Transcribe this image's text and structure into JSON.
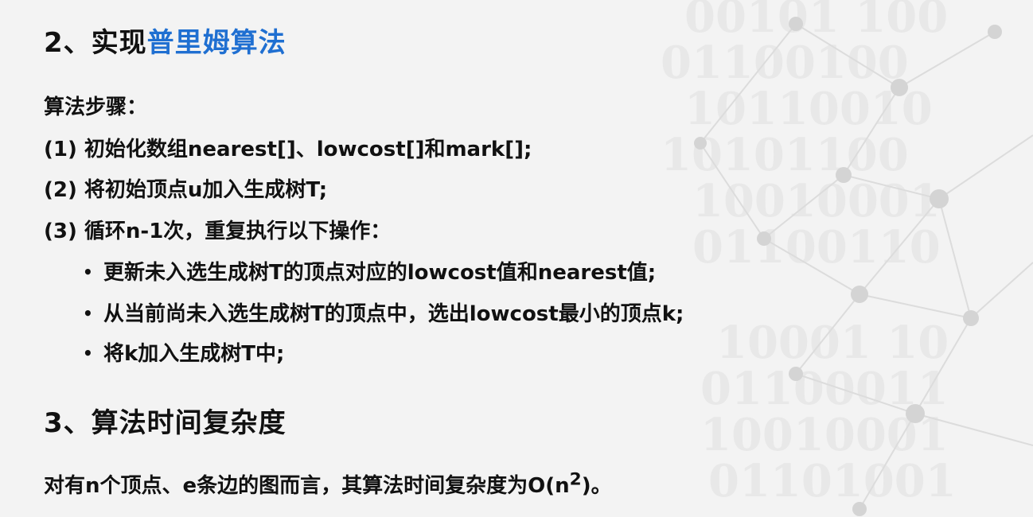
{
  "section2": {
    "prefix": "2、实现",
    "highlight": "普里姆算法"
  },
  "steps_label": "算法步骤：",
  "steps": [
    "(1) 初始化数组nearest[]、lowcost[]和mark[];",
    "(2) 将初始顶点u加入生成树T;",
    "(3) 循环n-1次，重复执行以下操作："
  ],
  "bullet_char": "•",
  "bullets": [
    "更新未入选生成树T的顶点对应的lowcost值和nearest值;",
    "从当前尚未入选生成树T的顶点中，选出lowcost最小的顶点k;",
    "将k加入生成树T中;"
  ],
  "section3": {
    "title": "3、算法时间复杂度"
  },
  "complexity": {
    "text": "对有n个顶点、e条边的图而言，其算法时间复杂度为O(n",
    "superscript": "2",
    "suffix": ")。"
  },
  "colors": {
    "highlight": "#1f6fd1",
    "text": "#111111",
    "background": "#f3f3f3"
  }
}
